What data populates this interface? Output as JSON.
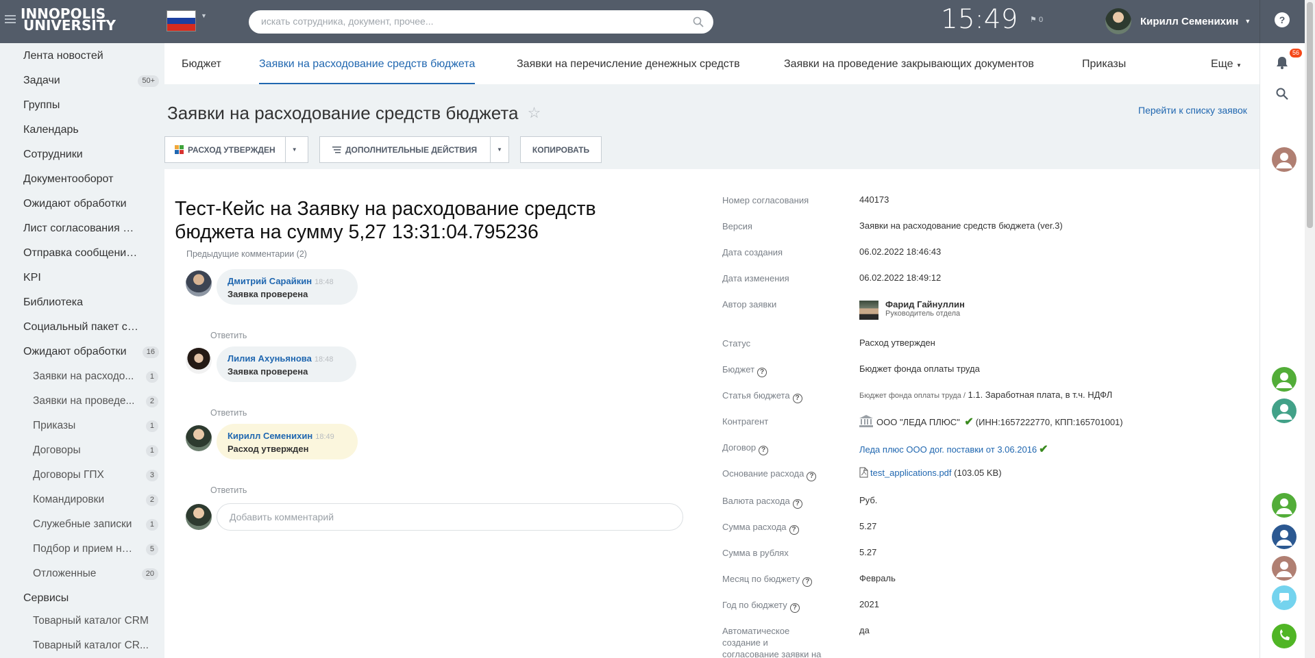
{
  "header": {
    "logo_line1": "INNOPOLIS",
    "logo_line2": "UNIVERSITY",
    "search_placeholder": "искать сотрудника, документ, прочее...",
    "clock": "15:49",
    "flag_count": "0",
    "user_name": "Кирилл Семенихин"
  },
  "colors": {
    "header_bg": "#535c69",
    "accent": "#2067b0",
    "notif_badge": "#f54819",
    "check": "#3a8a1f"
  },
  "leftmenu": {
    "items": [
      {
        "label": "Лента новостей"
      },
      {
        "label": "Задачи",
        "badge": "50+"
      },
      {
        "label": "Группы"
      },
      {
        "label": "Календарь"
      },
      {
        "label": "Сотрудники"
      },
      {
        "label": "Документооборот"
      },
      {
        "label": "Ожидают обработки"
      },
      {
        "label": "Лист согласования доку..."
      },
      {
        "label": "Отправка сообщений (С..."
      },
      {
        "label": "KPI"
      },
      {
        "label": "Библиотека"
      },
      {
        "label": "Социальный пакет сотру..."
      },
      {
        "label": "Ожидают обработки",
        "badge": "16"
      }
    ],
    "subitems": [
      {
        "label": "Заявки на расходо...",
        "badge": "1"
      },
      {
        "label": "Заявки на проведе...",
        "badge": "2"
      },
      {
        "label": "Приказы",
        "badge": "1"
      },
      {
        "label": "Договоры",
        "badge": "1"
      },
      {
        "label": "Договоры ГПХ",
        "badge": "3"
      },
      {
        "label": "Командировки",
        "badge": "2"
      },
      {
        "label": "Служебные записки",
        "badge": "1"
      },
      {
        "label": "Подбор и прием но...",
        "badge": "5"
      },
      {
        "label": "Отложенные",
        "badge": "20"
      }
    ],
    "services": "Сервисы",
    "service_items": [
      {
        "label": "Товарный каталог CRM"
      },
      {
        "label": "Товарный каталог CR..."
      }
    ]
  },
  "tabs": [
    {
      "label": "Бюджет"
    },
    {
      "label": "Заявки на расходование средств бюджета"
    },
    {
      "label": "Заявки на перечисление денежных средств"
    },
    {
      "label": "Заявки на проведение закрывающих документов"
    },
    {
      "label": "Приказы"
    }
  ],
  "tab_more": "Еще",
  "page": {
    "title": "Заявки на расходование средств бюджета",
    "goto_link": "Перейти к списку заявок",
    "btn_status": "Расход утвержден",
    "btn_actions": "Дополнительные действия",
    "btn_copy": "Копировать"
  },
  "doc": {
    "title_line1": "Тест-Кейс на Заявку на расходование средств",
    "title_line2": "бюджета на сумму 5,27 13:31:04.795236",
    "prev_comments_label": "Предыдущие комментарии",
    "prev_comments_count": "2",
    "reply_label": "Ответить",
    "add_comment_placeholder": "Добавить комментарий",
    "comments": [
      {
        "author": "Дмитрий Сарайкин",
        "time": "18:48",
        "text": "Заявка проверена"
      },
      {
        "author": "Лилия Ахуньянова",
        "time": "18:48",
        "text": "Заявка проверена"
      },
      {
        "author": "Кирилл Семенихин",
        "time": "18:49",
        "text": "Расход утвержден"
      }
    ]
  },
  "props": {
    "number_label": "Номер согласования",
    "number": "440173",
    "version_label": "Версия",
    "version": "Заявки на расходование средств бюджета (ver.3)",
    "created_label": "Дата создания",
    "created": "06.02.2022 18:46:43",
    "modified_label": "Дата изменения",
    "modified": "06.02.2022 18:49:12",
    "author_label": "Автор заявки",
    "author_name": "Фарид Гайнуллин",
    "author_role": "Руководитель отдела",
    "status_label": "Статус",
    "status": "Расход утвержден",
    "budget_label": "Бюджет",
    "budget": "Бюджет фонда оплаты труда",
    "article_label": "Статья бюджета",
    "article_prefix": "Бюджет фонда оплаты труда /",
    "article": "1.1. Заработная плата, в т.ч. НДФЛ",
    "counterparty_label": "Контрагент",
    "counterparty": "ООО \"ЛЕДА ПЛЮС\"",
    "counterparty_inn": "(ИНН:1657222770, КПП:165701001)",
    "contract_label": "Договор",
    "contract": "Леда плюс ООО дог. поставки от 3.06.2016",
    "basis_label": "Основание расхода",
    "basis_file": "test_applications.pdf",
    "basis_size": "(103.05 KB)",
    "currency_label": "Валюта расхода",
    "currency": "Руб.",
    "sum_label": "Сумма расхода",
    "sum": "5.27",
    "sum_rub_label": "Сумма в рублях",
    "sum_rub": "5.27",
    "month_label": "Месяц по бюджету",
    "month": "Февраль",
    "year_label": "Год по бюджету",
    "year": "2021",
    "auto_label": "Автоматическое создание и согласование заявки на перечисление денежных",
    "auto": "да"
  },
  "rightbar": {
    "notif_count": "56"
  }
}
